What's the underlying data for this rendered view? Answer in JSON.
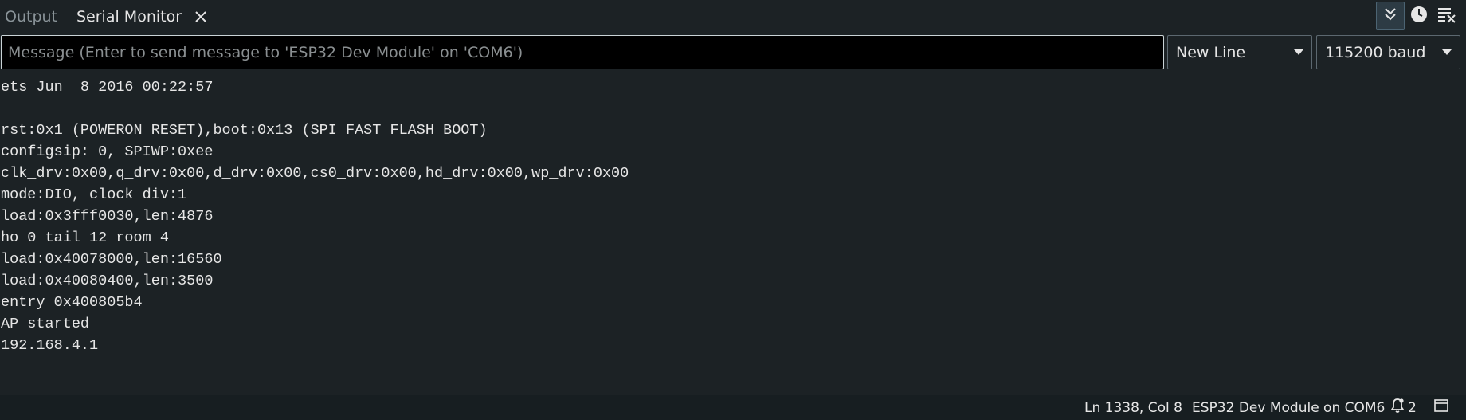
{
  "tabs": {
    "output_label": "Output",
    "serial_label": "Serial Monitor"
  },
  "toolbar": {
    "autoscroll_icon": "double-chevron-down-icon",
    "timestamp_icon": "clock-icon",
    "clear_icon": "clear-output-icon"
  },
  "message": {
    "placeholder": "Message (Enter to send message to 'ESP32 Dev Module' on 'COM6')",
    "value": ""
  },
  "line_ending": {
    "selected": "New Line"
  },
  "baud": {
    "selected": "115200 baud"
  },
  "output_lines": [
    "ets Jun  8 2016 00:22:57",
    "",
    "rst:0x1 (POWERON_RESET),boot:0x13 (SPI_FAST_FLASH_BOOT)",
    "configsip: 0, SPIWP:0xee",
    "clk_drv:0x00,q_drv:0x00,d_drv:0x00,cs0_drv:0x00,hd_drv:0x00,wp_drv:0x00",
    "mode:DIO, clock div:1",
    "load:0x3fff0030,len:4876",
    "ho 0 tail 12 room 4",
    "load:0x40078000,len:16560",
    "load:0x40080400,len:3500",
    "entry 0x400805b4",
    "AP started",
    "192.168.4.1"
  ],
  "status": {
    "position": "Ln 1338, Col 8",
    "board": "ESP32 Dev Module on COM6",
    "notifications_count": "2"
  },
  "colors": {
    "background": "#1c2225",
    "statusbar": "#171e21",
    "input_background": "#000000",
    "text": "#e6e6e6"
  }
}
